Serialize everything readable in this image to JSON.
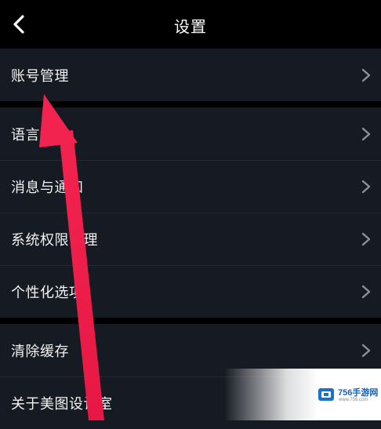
{
  "header": {
    "title": "设置",
    "back_icon": "chevron-left-icon"
  },
  "groups": [
    {
      "items": [
        {
          "label": "账号管理"
        }
      ]
    },
    {
      "items": [
        {
          "label": "语言设置"
        },
        {
          "label": "消息与通知"
        },
        {
          "label": "系统权限管理"
        },
        {
          "label": "个性化选项"
        }
      ]
    },
    {
      "items": [
        {
          "label": "清除缓存"
        },
        {
          "label": "关于美图设计室"
        }
      ]
    }
  ],
  "annotation": {
    "color": "#ef1f4b",
    "icon": "red-arrow-pointer"
  },
  "watermark": {
    "brand": "756手游网",
    "url": "www.756.com",
    "icon": "756-logo-icon"
  }
}
